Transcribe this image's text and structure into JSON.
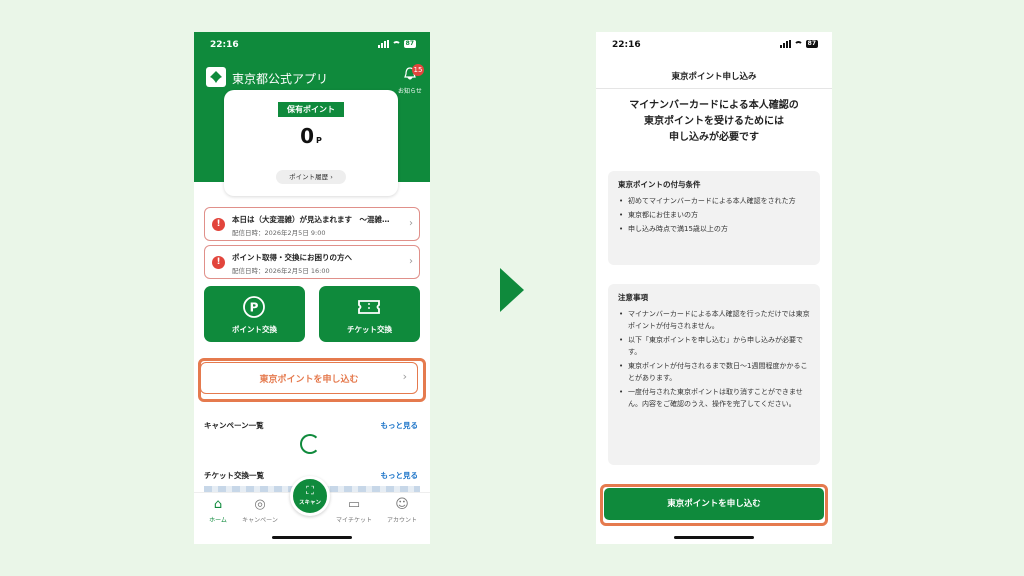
{
  "colors": {
    "brand_green": "#0f8a3c",
    "highlight_orange": "#e57a4e",
    "alert_red": "#e2453c",
    "link_blue": "#1a73c8",
    "background": "#eaf6e8"
  },
  "left": {
    "status": {
      "time": "22:16",
      "battery": "87"
    },
    "header": {
      "app_title": "東京都公式アプリ",
      "logo_icon": "tokyo-ginkgo-logo",
      "bell_badge": "15",
      "bell_label": "お知らせ"
    },
    "points": {
      "tag": "保有ポイント",
      "value": "0",
      "unit": "P",
      "history_button": "ポイント履歴 ›"
    },
    "notices": [
      {
        "title": "本日は（大変混雑）が見込まれます　〜混雑…",
        "date": "配信日時：2026年2月5日 9:00"
      },
      {
        "title": "ポイント取得・交換にお困りの方へ",
        "date": "配信日時：2026年2月5日 16:00"
      }
    ],
    "tiles": {
      "points_exchange": "ポイント交換",
      "ticket_exchange": "チケット交換"
    },
    "apply_button": "東京ポイントを申し込む",
    "campaign_section": {
      "title": "キャンペーン一覧",
      "more": "もっと見る"
    },
    "ticket_section": {
      "title": "チケット交換一覧",
      "more": "もっと見る"
    },
    "tabs": {
      "home": "ホーム",
      "campaign": "キャンペーン",
      "scan": "スキャン",
      "my_ticket": "マイチケット",
      "account": "アカウント"
    }
  },
  "right": {
    "status": {
      "time": "22:16",
      "battery": "87"
    },
    "title": "東京ポイント申し込み",
    "headline": [
      "マイナンバーカードによる本人確認の",
      "東京ポイントを受けるためには",
      "申し込みが必要です"
    ],
    "conditions": {
      "heading": "東京ポイントの付与条件",
      "items": [
        "初めてマイナンバーカードによる本人確認をされた方",
        "東京都にお住まいの方",
        "申し込み時点で満15歳以上の方"
      ]
    },
    "notes": {
      "heading": "注意事項",
      "items": [
        "マイナンバーカードによる本人確認を行っただけでは東京ポイントが付与されません。",
        "以下「東京ポイントを申し込む」から申し込みが必要です。",
        "東京ポイントが付与されるまで数日〜1週間程度かかることがあります。",
        "一度付与された東京ポイントは取り消すことができません。内容をご確認のうえ、操作を完了してください。"
      ]
    },
    "apply_button": "東京ポイントを申し込む"
  }
}
